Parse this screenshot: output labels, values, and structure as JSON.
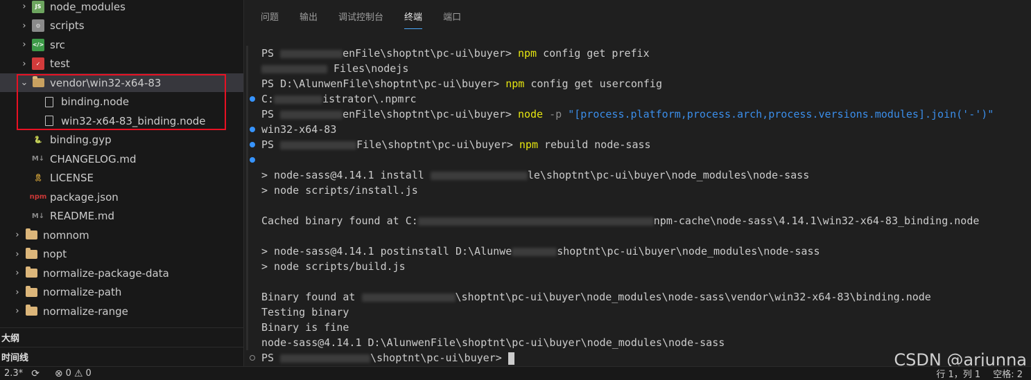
{
  "explorer": {
    "items": [
      {
        "label": "node_modules",
        "kind": "folder-node",
        "chevron": "›",
        "indent": 1
      },
      {
        "label": "scripts",
        "kind": "folder-scripts",
        "chevron": "›",
        "indent": 1
      },
      {
        "label": "src",
        "kind": "folder-src",
        "chevron": "›",
        "indent": 1
      },
      {
        "label": "test",
        "kind": "folder-test",
        "chevron": "›",
        "indent": 1
      },
      {
        "label": "vendor\\win32-x64-83",
        "kind": "folder-open",
        "chevron": "⌄",
        "indent": 1
      },
      {
        "label": "binding.node",
        "kind": "file",
        "chevron": "",
        "indent": 2
      },
      {
        "label": "win32-x64-83_binding.node",
        "kind": "file",
        "chevron": "",
        "indent": 2
      },
      {
        "label": "binding.gyp",
        "kind": "python",
        "chevron": "",
        "indent": 1
      },
      {
        "label": "CHANGELOG.md",
        "kind": "markdown",
        "chevron": "",
        "indent": 1
      },
      {
        "label": "LICENSE",
        "kind": "license",
        "chevron": "",
        "indent": 1
      },
      {
        "label": "package.json",
        "kind": "npm",
        "chevron": "",
        "indent": 1
      },
      {
        "label": "README.md",
        "kind": "markdown",
        "chevron": "",
        "indent": 1
      },
      {
        "label": "nomnom",
        "kind": "folder",
        "chevron": "›",
        "indent": 0
      },
      {
        "label": "nopt",
        "kind": "folder",
        "chevron": "›",
        "indent": 0
      },
      {
        "label": "normalize-package-data",
        "kind": "folder",
        "chevron": "›",
        "indent": 0
      },
      {
        "label": "normalize-path",
        "kind": "folder",
        "chevron": "›",
        "indent": 0
      },
      {
        "label": "normalize-range",
        "kind": "folder",
        "chevron": "›",
        "indent": 0
      }
    ],
    "outline_title": "大纲",
    "timeline_title": "时间线"
  },
  "panel": {
    "tabs": [
      "问题",
      "输出",
      "调试控制台",
      "终端",
      "端口"
    ],
    "active_tab": "终端"
  },
  "terminal": {
    "lines": [
      {
        "dot": "",
        "parts": [
          {
            "t": "PS "
          },
          {
            "blur": 90
          },
          {
            "t": "enFile\\shoptnt\\pc-ui\\buyer> "
          },
          {
            "t": "npm",
            "c": "y"
          },
          {
            "t": " config get prefix"
          }
        ]
      },
      {
        "dot": "",
        "parts": [
          {
            "blur": 95
          },
          {
            "t": " Files\\nodejs"
          }
        ]
      },
      {
        "dot": "",
        "parts": [
          {
            "t": "PS D:\\AlunwenFile\\shoptnt\\pc-ui\\buyer> "
          },
          {
            "t": "npm",
            "c": "y"
          },
          {
            "t": " config get userconfig"
          }
        ]
      },
      {
        "dot": "blue",
        "parts": [
          {
            "t": "C:"
          },
          {
            "blur": 70
          },
          {
            "t": "istrator\\.npmrc"
          }
        ]
      },
      {
        "dot": "",
        "parts": [
          {
            "t": "PS "
          },
          {
            "blur": 90
          },
          {
            "t": "enFile\\shoptnt\\pc-ui\\buyer> "
          },
          {
            "t": "node",
            "c": "y"
          },
          {
            "t": " -p ",
            "c": "gray"
          },
          {
            "t": "\"[process.platform,process.arch,process.versions.modules].join('-')\"",
            "c": "str"
          }
        ]
      },
      {
        "dot": "blue",
        "parts": [
          {
            "t": "win32-x64-83"
          }
        ]
      },
      {
        "dot": "blue",
        "parts": [
          {
            "t": "PS "
          },
          {
            "blur": 110
          },
          {
            "t": "File\\shoptnt\\pc-ui\\buyer> "
          },
          {
            "t": "npm",
            "c": "y"
          },
          {
            "t": " rebuild node-sass"
          }
        ]
      },
      {
        "dot": "blue",
        "parts": []
      },
      {
        "dot": "",
        "parts": [
          {
            "t": "> node-sass@4.14.1 install "
          },
          {
            "blur": 140
          },
          {
            "t": "le\\shoptnt\\pc-ui\\buyer\\node_modules\\node-sass"
          }
        ]
      },
      {
        "dot": "",
        "parts": [
          {
            "t": "> node scripts/install.js"
          }
        ]
      },
      {
        "dot": "",
        "parts": []
      },
      {
        "dot": "",
        "parts": [
          {
            "t": "Cached binary found at C:"
          },
          {
            "blur": 340
          },
          {
            "t": "npm-cache\\node-sass\\4.14.1\\win32-x64-83_binding.node"
          }
        ]
      },
      {
        "dot": "",
        "parts": []
      },
      {
        "dot": "",
        "parts": [
          {
            "t": "> node-sass@4.14.1 postinstall D:\\Alunwe"
          },
          {
            "blur": 65
          },
          {
            "t": "shoptnt\\pc-ui\\buyer\\node_modules\\node-sass"
          }
        ]
      },
      {
        "dot": "",
        "parts": [
          {
            "t": "> node scripts/build.js"
          }
        ]
      },
      {
        "dot": "",
        "parts": []
      },
      {
        "dot": "",
        "parts": [
          {
            "t": "Binary found at "
          },
          {
            "blur": 135
          },
          {
            "t": "\\shoptnt\\pc-ui\\buyer\\node_modules\\node-sass\\vendor\\win32-x64-83\\binding.node"
          }
        ]
      },
      {
        "dot": "",
        "parts": [
          {
            "t": "Testing binary"
          }
        ]
      },
      {
        "dot": "",
        "parts": [
          {
            "t": "Binary is fine"
          }
        ]
      },
      {
        "dot": "",
        "parts": [
          {
            "t": "node-sass@4.14.1 D:\\AlunwenFile\\shoptnt\\pc-ui\\buyer\\node_modules\\node-sass"
          }
        ]
      },
      {
        "dot": "hollow",
        "parts": [
          {
            "t": "PS "
          },
          {
            "blur": 130
          },
          {
            "t": "\\shoptnt\\pc-ui\\buyer> "
          },
          {
            "cursor": true
          }
        ]
      }
    ]
  },
  "watermark": "CSDN @arjunna",
  "statusbar": {
    "version": "2.3*",
    "errors": "0",
    "warnings": "0",
    "position": "行 1，列 1",
    "spaces": "空格: 2"
  }
}
